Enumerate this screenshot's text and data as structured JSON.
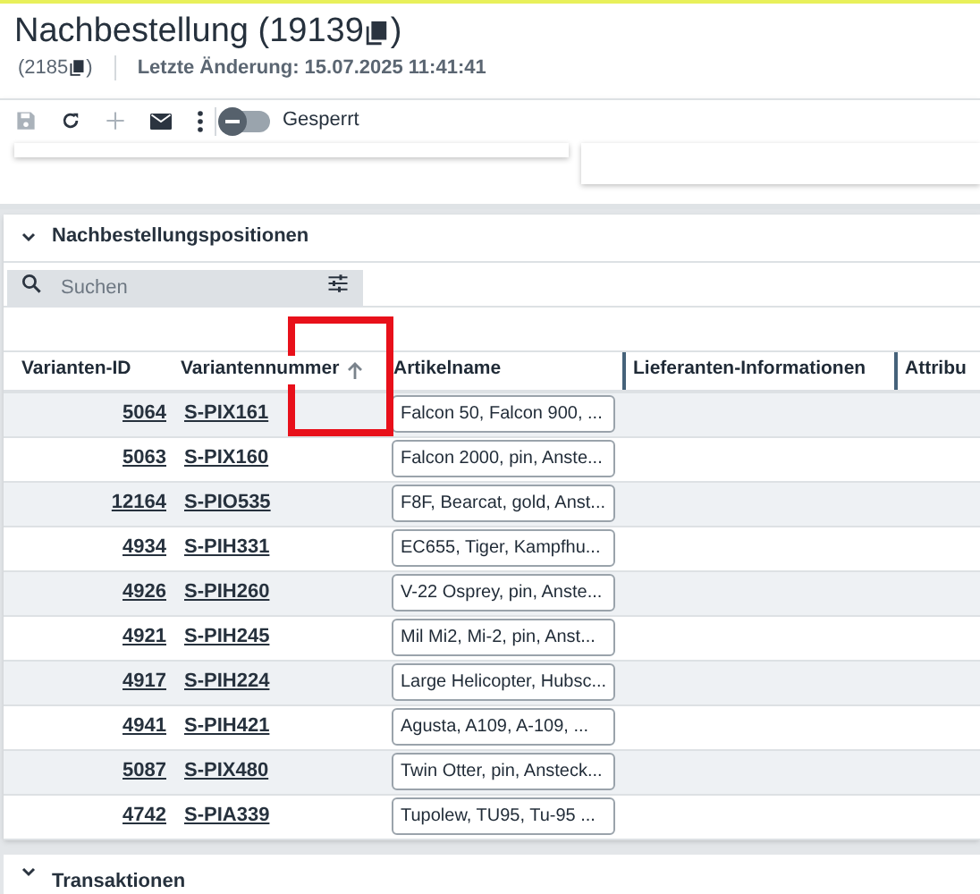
{
  "header": {
    "title": "Nachbestellung (19139",
    "title_end": ")",
    "sub_open": "(2185",
    "sub_close": ")",
    "last_change": "Letzte Änderung: 15.07.2025 11:41:41"
  },
  "toolbar": {
    "save_disabled": true,
    "add_disabled": true,
    "toggle": {
      "label": "Gesperrt",
      "on": false
    }
  },
  "section": {
    "title": "Nachbestellungspositionen",
    "expanded": true,
    "search": {
      "placeholder": "Suchen"
    },
    "table": {
      "columns": [
        {
          "label": "Varianten-ID",
          "sorted": false
        },
        {
          "label": "Variantennummer",
          "sorted": true
        },
        {
          "label": "Artikelname",
          "sorted": false
        },
        {
          "label": "Lieferanten-Informationen",
          "sorted": false
        },
        {
          "label": "Attribu",
          "sorted": false
        }
      ],
      "rows": [
        {
          "id": "5064",
          "number": "S-PIX161",
          "name": "Falcon 50, Falcon 900, ..."
        },
        {
          "id": "5063",
          "number": "S-PIX160",
          "name": "Falcon 2000, pin, Anste..."
        },
        {
          "id": "12164",
          "number": "S-PIO535",
          "name": "F8F, Bearcat, gold, Anst..."
        },
        {
          "id": "4934",
          "number": "S-PIH331",
          "name": "EC655, Tiger, Kampfhu..."
        },
        {
          "id": "4926",
          "number": "S-PIH260",
          "name": "V-22 Osprey, pin, Anste..."
        },
        {
          "id": "4921",
          "number": "S-PIH245",
          "name": "Mil Mi2, Mi-2, pin, Anst..."
        },
        {
          "id": "4917",
          "number": "S-PIH224",
          "name": "Large Helicopter, Hubsc..."
        },
        {
          "id": "4941",
          "number": "S-PIH421",
          "name": "Agusta, A109, A-109,  ..."
        },
        {
          "id": "5087",
          "number": "S-PIX480",
          "name": "Twin Otter, pin, Ansteck..."
        },
        {
          "id": "4742",
          "number": "S-PIA339",
          "name": "Tupolew, TU95, Tu-95 ..."
        }
      ]
    }
  },
  "section2": {
    "title": "Transaktionen",
    "expanded": true
  }
}
